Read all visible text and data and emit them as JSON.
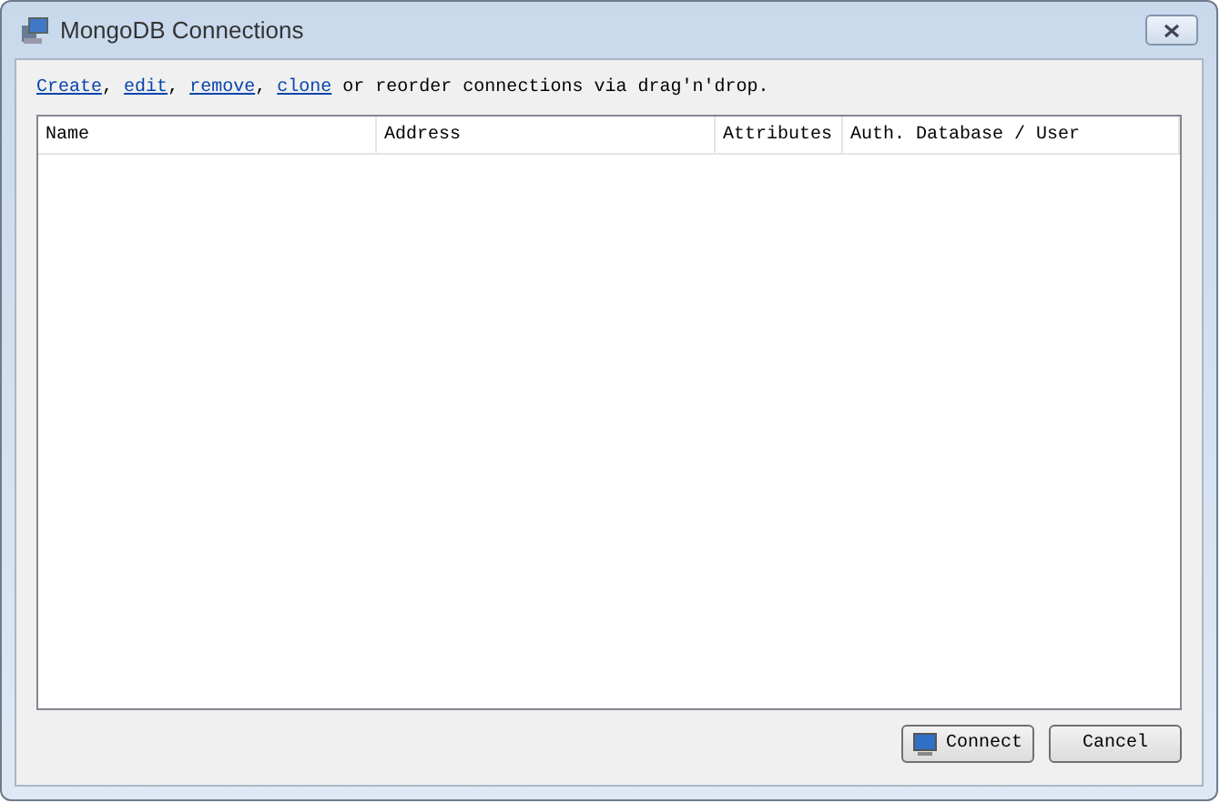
{
  "window": {
    "title": "MongoDB Connections"
  },
  "intro": {
    "links": [
      {
        "label": "Create",
        "suffix": ","
      },
      {
        "label": "edit",
        "suffix": ","
      },
      {
        "label": "remove",
        "suffix": ","
      },
      {
        "label": "clone"
      }
    ],
    "text": "or reorder connections via drag'n'drop."
  },
  "table": {
    "columns": [
      "Name",
      "Address",
      "Attributes",
      "Auth. Database / User"
    ]
  },
  "buttons": [
    {
      "label": "Connect",
      "kind": "connect"
    },
    {
      "label": "Cancel",
      "kind": "cancel"
    }
  ]
}
